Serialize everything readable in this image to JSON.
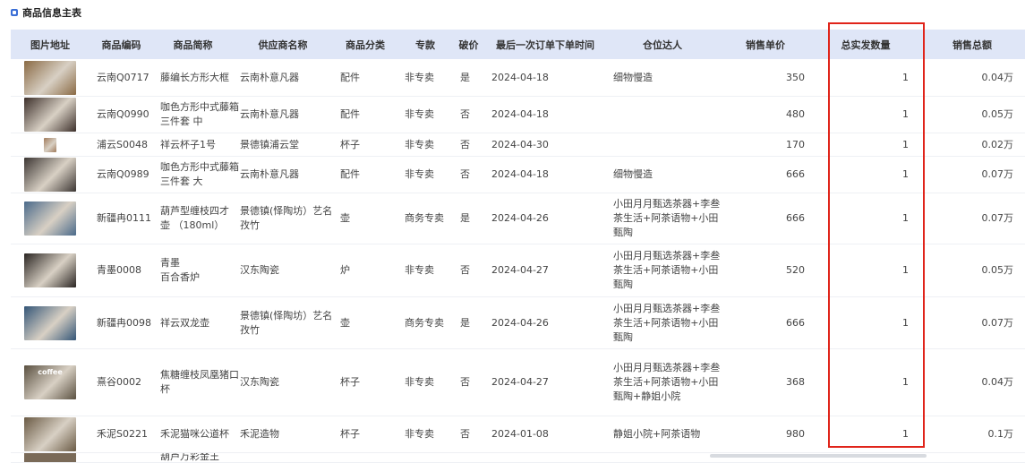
{
  "title": "商品信息主表",
  "columns": [
    "图片地址",
    "商品编码",
    "商品简称",
    "供应商名称",
    "商品分类",
    "专款",
    "破价",
    "最后一次订单下单时间",
    "仓位达人",
    "销售单价",
    "总实发数量",
    "销售总额"
  ],
  "rows": [
    {
      "code": "云南Q0717",
      "name": "藤编长方形大框",
      "supplier": "云南朴意凡器",
      "category": "配件",
      "special": "非专卖",
      "broken": "是",
      "date": "2024-04-18",
      "expert": "细物慢造",
      "price": "350",
      "qty": "1",
      "total": "0.04万"
    },
    {
      "code": "云南Q0990",
      "name": "咖色方形中式藤箱三件套 中",
      "supplier": "云南朴意凡器",
      "category": "配件",
      "special": "非专卖",
      "broken": "否",
      "date": "2024-04-18",
      "expert": "",
      "price": "480",
      "qty": "1",
      "total": "0.05万"
    },
    {
      "code": "浦云S0048",
      "name": "祥云杯子1号",
      "supplier": "景德镇浦云堂",
      "category": "杯子",
      "special": "非专卖",
      "broken": "否",
      "date": "2024-04-30",
      "expert": "",
      "price": "170",
      "qty": "1",
      "total": "0.02万"
    },
    {
      "code": "云南Q0989",
      "name": "咖色方形中式藤箱三件套 大",
      "supplier": "云南朴意凡器",
      "category": "配件",
      "special": "非专卖",
      "broken": "否",
      "date": "2024-04-18",
      "expert": "细物慢造",
      "price": "666",
      "qty": "1",
      "total": "0.07万"
    },
    {
      "code": "新疆冉0111",
      "name": "葫芦型缠枝四才 壶 （180ml）",
      "supplier": "景德镇(怿陶坊）艺名孜竹",
      "category": "壶",
      "special": "商务专卖",
      "broken": "是",
      "date": "2024-04-26",
      "expert": "小田月月甄选茶器+李叁茶生活+阿茶语物+小田甄陶",
      "price": "666",
      "qty": "1",
      "total": "0.07万"
    },
    {
      "code": "青墨0008",
      "name": "青墨\n百合香炉",
      "supplier": "汉东陶瓷",
      "category": "炉",
      "special": "非专卖",
      "broken": "否",
      "date": "2024-04-27",
      "expert": "小田月月甄选茶器+李叁茶生活+阿茶语物+小田甄陶",
      "price": "520",
      "qty": "1",
      "total": "0.05万"
    },
    {
      "code": "新疆冉0098",
      "name": "祥云双龙壶",
      "supplier": "景德镇(怿陶坊）艺名孜竹",
      "category": "壶",
      "special": "商务专卖",
      "broken": "是",
      "date": "2024-04-26",
      "expert": "小田月月甄选茶器+李叁茶生活+阿茶语物+小田甄陶",
      "price": "666",
      "qty": "1",
      "total": "0.07万"
    },
    {
      "code": "熹谷0002",
      "name": "焦糖缠枝凤凰猪口杯",
      "supplier": "汉东陶瓷",
      "category": "杯子",
      "special": "非专卖",
      "broken": "否",
      "date": "2024-04-27",
      "expert": "小田月月甄选茶器+李叁茶生活+阿茶语物+小田甄陶+静姐小院",
      "price": "368",
      "qty": "1",
      "total": "0.04万"
    },
    {
      "code": "禾泥S0221",
      "name": "禾泥猫咪公道杯",
      "supplier": "禾泥造物",
      "category": "杯子",
      "special": "非专卖",
      "broken": "否",
      "date": "2024-01-08",
      "expert": "静姐小院+阿茶语物",
      "price": "980",
      "qty": "1",
      "total": "0.1万"
    }
  ],
  "partial_row_name": "葫芦万彩金王",
  "thumb_colors": [
    "#8a6a44",
    "#3c2f2a",
    "#a07a5a",
    "#3b3532",
    "#4a6a8a",
    "#2a2522",
    "#335577",
    "#5a5040",
    "#6a5a44"
  ],
  "coffee_label": "coffee",
  "accent": "#e0241a",
  "header_bg": "#dfe6f7"
}
